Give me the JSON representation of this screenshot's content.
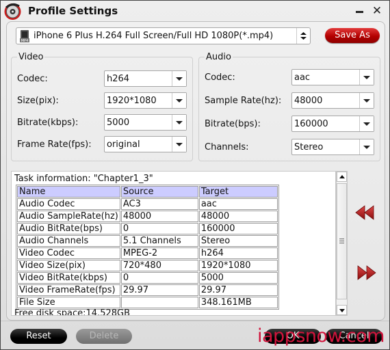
{
  "window": {
    "title": "Profile Settings",
    "app_icon": "dvd-disc-icon",
    "minimize_icon": "minimize-icon",
    "close_icon": "close-icon",
    "close_glyph": "✕"
  },
  "profile": {
    "selected": "iPhone 6 Plus H.264 Full Screen/Full HD 1080P(*.mp4)",
    "icon": "mp4-file-icon",
    "save_as_label": "Save As"
  },
  "video": {
    "legend": "Video",
    "fields": [
      {
        "label": "Codec:",
        "value": "h264"
      },
      {
        "label": "Size(pix):",
        "value": "1920*1080"
      },
      {
        "label": "Bitrate(kbps):",
        "value": "5000"
      },
      {
        "label": "Frame Rate(fps):",
        "value": "original"
      }
    ]
  },
  "audio": {
    "legend": "Audio",
    "fields": [
      {
        "label": "Codec:",
        "value": "aac"
      },
      {
        "label": "Sample Rate(hz):",
        "value": "48000"
      },
      {
        "label": "Bitrate(bps):",
        "value": "160000"
      },
      {
        "label": "Channels:",
        "value": "Stereo"
      }
    ]
  },
  "task": {
    "title": "Task information: \"Chapter1_3\"",
    "headers": [
      "Name",
      "Source",
      "Target"
    ],
    "rows": [
      [
        "Audio Codec",
        "AC3",
        "aac"
      ],
      [
        "Audio SampleRate(hz)",
        "48000",
        "48000"
      ],
      [
        "Audio BitRate(bps)",
        "0",
        "160000"
      ],
      [
        "Audio Channels",
        "5.1 Channels",
        "Stereo"
      ],
      [
        "Video Codec",
        "MPEG-2",
        "h264"
      ],
      [
        "Video Size(pix)",
        "720*480",
        "1920*1080"
      ],
      [
        "Video BitRate(kbps)",
        "0",
        "5000"
      ],
      [
        "Video FrameRate(fps)",
        "29.97",
        "29.97"
      ],
      [
        "File Size",
        "",
        "348.161MB"
      ]
    ],
    "free_disk": "Free disk space:14.528GB"
  },
  "nav": {
    "prev_icon": "rewind-icon",
    "next_icon": "fast-forward-icon"
  },
  "footer": {
    "reset_label": "Reset",
    "delete_label": "Delete",
    "ok_label": "OK",
    "cancel_label": "Cancel"
  },
  "watermark": "iappsnow.com",
  "colors": {
    "accent_red": "#b30000",
    "table_header_bg": "#ccccff",
    "watermark": "#d0143c"
  }
}
